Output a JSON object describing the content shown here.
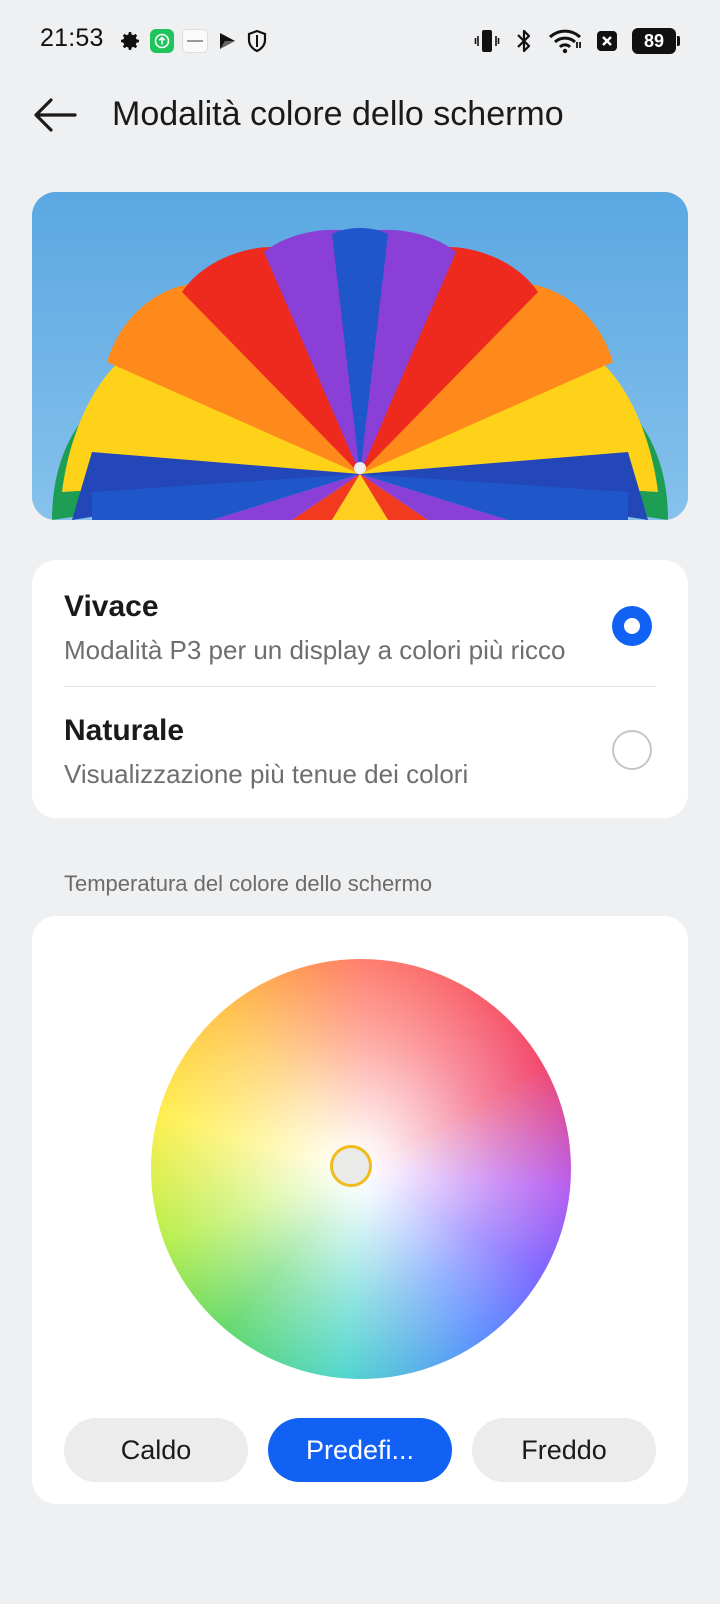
{
  "status_bar": {
    "time": "21:53",
    "left_icons": [
      "gear-icon",
      "app-update-icon",
      "app-badge-icon",
      "play-icon",
      "shield-icon"
    ],
    "right_icons": [
      "vibrate-icon",
      "bluetooth-icon",
      "wifi-icon",
      "close-box-icon",
      "battery-icon"
    ],
    "battery": "89"
  },
  "header": {
    "title": "Modalità colore dello schermo"
  },
  "color_mode": {
    "options": [
      {
        "title": "Vivace",
        "description": "Modalità P3 per un display a colori più ricco",
        "selected": true
      },
      {
        "title": "Naturale",
        "description": "Visualizzazione più tenue dei colori",
        "selected": false
      }
    ]
  },
  "temperature": {
    "section_label": "Temperatura del colore dello schermo",
    "buttons": [
      {
        "label": "Caldo",
        "active": false
      },
      {
        "label": "Predefi...",
        "active": true
      },
      {
        "label": "Freddo",
        "active": false
      }
    ]
  },
  "colors": {
    "accent": "#1261f5",
    "handle_ring": "#f1bb1d",
    "background": "#eff0f2"
  }
}
